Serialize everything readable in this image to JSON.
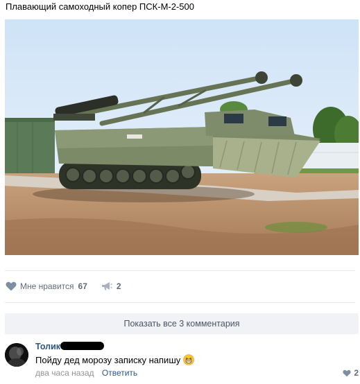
{
  "post": {
    "title": "Плавающий самоходный копер ПСК-М-2-500",
    "photo_icon": "amphibious-pile-driver-vehicle"
  },
  "actions": {
    "like_label": "Мне нравится",
    "like_count": "67",
    "like_icon": "heart-icon",
    "share_count": "2",
    "share_icon": "megaphone-icon"
  },
  "comments": {
    "show_all_label": "Показать все 3 комментария",
    "items": [
      {
        "author": "Толик",
        "text": "Пойду дед морозу записку напишу",
        "time": "два часа назад",
        "reply_label": "Ответить",
        "like_count": "2"
      }
    ]
  },
  "colors": {
    "link": "#2a5885",
    "icon": "#7e8fa2",
    "secondary_text": "#939393",
    "button_bg": "#f0f2f5"
  }
}
